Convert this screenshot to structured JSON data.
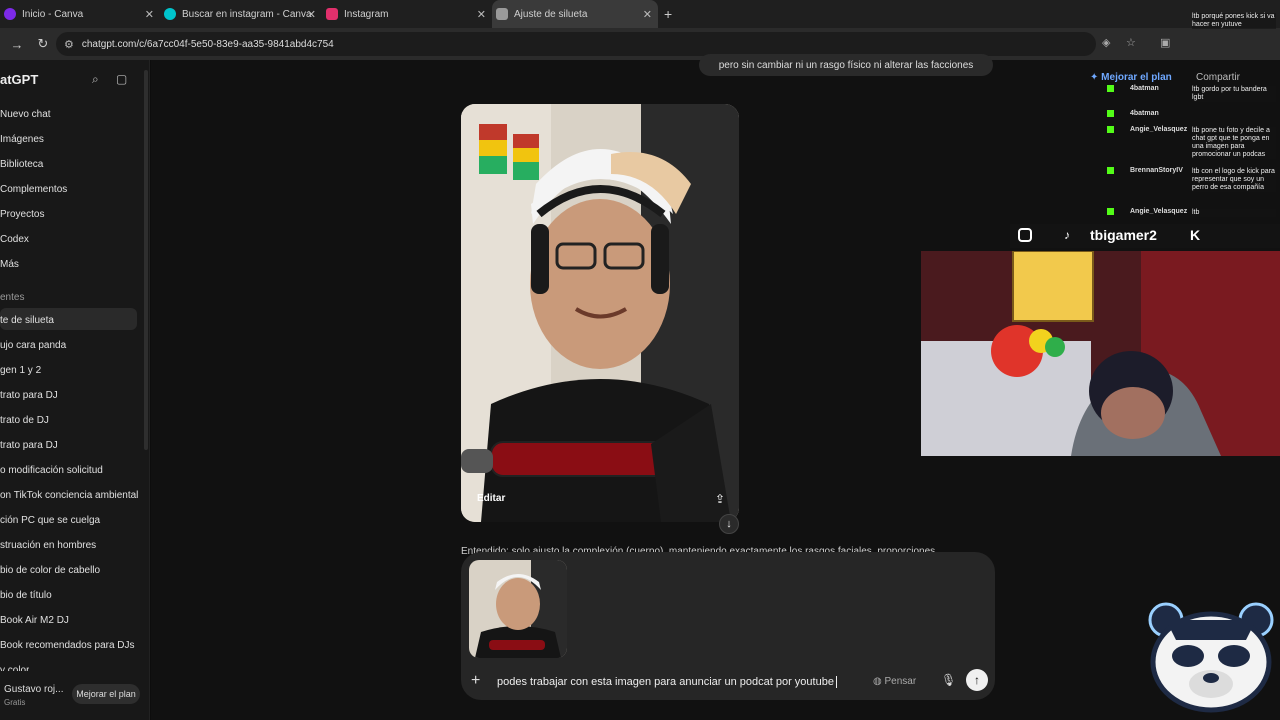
{
  "tabs": [
    {
      "label": "Inicio - Canva",
      "color": "#7d2ae8",
      "active": false
    },
    {
      "label": "Buscar en instagram - Canva",
      "color": "#00c4cc",
      "active": false
    },
    {
      "label": "Instagram",
      "color": "#e1306c",
      "active": false
    },
    {
      "label": "Ajuste de silueta",
      "color": "#9a9a9a",
      "active": true
    }
  ],
  "address": {
    "url": "chatgpt.com/c/6a7cc04f-5e50-83e9-aa35-9841abd4c754"
  },
  "sidebar": {
    "brand": "atGPT",
    "nav": [
      "Nuevo chat",
      "Imágenes",
      "Biblioteca",
      "Complementos",
      "Proyectos",
      "Codex",
      "Más"
    ],
    "section": "entes",
    "chats": [
      "te de silueta",
      "ujo cara panda",
      "gen 1 y 2",
      "trato para DJ",
      "trato de DJ",
      "trato para DJ",
      "o modificación solicitud",
      "on TikTok conciencia ambiental",
      "ción PC que se cuelga",
      "struación en hombres",
      "bio de color de cabello",
      "bio de título",
      "Book Air M2 DJ",
      "Book recomendados para DJs",
      "y color"
    ],
    "user": "Gustavo roj...",
    "plan": "Gratis",
    "upgrade": "Mejorar el plan"
  },
  "conversation": {
    "user_message": "pero sin cambiar ni un rasgo físico ni alterar las facciones",
    "image_edit_label": "Editar",
    "assistant_text": "Entendido: solo ajusto la complexión (cuerpo), manteniendo exactamente los rasgos faciales, proporciones"
  },
  "composer": {
    "prompt": "podes trabajar con esta imagen para anunciar un podcat por youtube",
    "think_label": "Pensar"
  },
  "header_right": {
    "upgrade": "Mejorar el plan",
    "share": "Compartir"
  },
  "stream_chat": [
    {
      "name": "4batman",
      "msg": "ltb porqué pones kick si va hacer en yutuve"
    },
    {
      "name": "4batman",
      "msg": "ltb gordo por tu bandera lgbt"
    },
    {
      "name": "Angie_Velasquez",
      "msg": "ltb pone tu foto y decile a chat gpt que te ponga en una imagen para promocionar un podcas"
    },
    {
      "name": "BrennanStoryIV",
      "msg": "ltb con el logo de kick para representar que soy un perro de esa compañía"
    },
    {
      "name": "Angie_Velasquez",
      "msg": "ltb"
    }
  ],
  "overlay": {
    "handle": "tbigamer2"
  }
}
